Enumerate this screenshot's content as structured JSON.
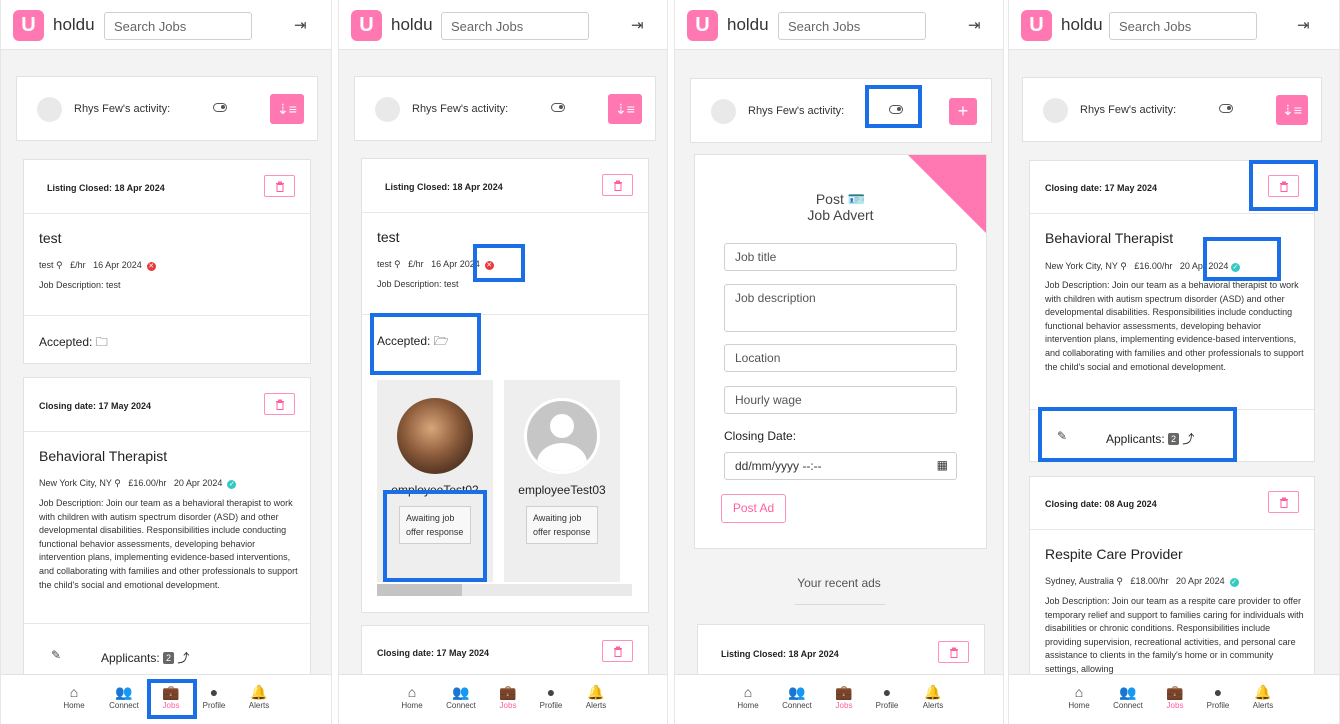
{
  "app": {
    "logo_letter": "U",
    "name": "holdu"
  },
  "search": {
    "placeholder": "Search Jobs"
  },
  "activity": {
    "label": "Rhys Few's activity:"
  },
  "nav": {
    "items": [
      "Home",
      "Connect",
      "Jobs",
      "Profile",
      "Alerts"
    ],
    "active": "Jobs"
  },
  "screen1": {
    "listing1": {
      "status": "Listing Closed: 18 Apr 2024",
      "title": "test",
      "location": "test",
      "wage": "£/hr",
      "date": "16 Apr 2024",
      "description": "Job Description: test",
      "accepted_label": "Accepted:"
    },
    "listing2": {
      "status": "Closing date: 17 May 2024",
      "title": "Behavioral Therapist",
      "location": "New York City, NY",
      "wage": "£16.00/hr",
      "date": "20 Apr 2024",
      "description": "Job Description: Join our team as a behavioral therapist to work with children with autism spectrum disorder (ASD) and other developmental disabilities. Responsibilities include conducting functional behavior assessments, developing behavior intervention plans, implementing evidence-based interventions, and collaborating with families and other professionals to support the child's social and emotional development.",
      "applicants_label": "Applicants:",
      "applicants_count": "2"
    }
  },
  "screen2": {
    "listing1": {
      "status": "Listing Closed: 18 Apr 2024",
      "title": "test",
      "location": "test",
      "wage": "£/hr",
      "date": "16 Apr 2024",
      "description": "Job Description: test",
      "accepted_label": "Accepted:"
    },
    "applicants": [
      {
        "name": "employeeTest02",
        "status": "Awaiting job offer response"
      },
      {
        "name": "employeeTest03",
        "status": "Awaiting job offer response"
      }
    ],
    "listing2": {
      "status": "Closing date: 17 May 2024"
    }
  },
  "screen3": {
    "post_title_1": "Post",
    "post_title_2": "Job Advert",
    "fields": {
      "job_title": "Job title",
      "job_description": "Job description",
      "location": "Location",
      "hourly_wage": "Hourly wage"
    },
    "closing_label": "Closing Date:",
    "date_placeholder": "dd/mm/yyyy --:--",
    "post_button": "Post Ad",
    "recent_heading": "Your recent ads",
    "recent_listing": {
      "status": "Listing Closed: 18 Apr 2024"
    }
  },
  "screen4": {
    "listing1": {
      "status": "Closing date: 17 May 2024",
      "title": "Behavioral Therapist",
      "location": "New York City, NY",
      "wage": "£16.00/hr",
      "date": "20 Apr 2024",
      "description": "Job Description: Join our team as a behavioral therapist to work with children with autism spectrum disorder (ASD) and other developmental disabilities. Responsibilities include conducting functional behavior assessments, developing behavior intervention plans, implementing evidence-based interventions, and collaborating with families and other professionals to support the child's social and emotional development.",
      "applicants_label": "Applicants:",
      "applicants_count": "2"
    },
    "listing2": {
      "status": "Closing date: 08 Aug 2024",
      "title": "Respite Care Provider",
      "location": "Sydney, Australia",
      "wage": "£18.00/hr",
      "date": "20 Apr 2024",
      "description": "Job Description: Join our team as a respite care provider to offer temporary relief and support to families caring for individuals with disabilities or chronic conditions. Responsibilities include providing supervision, recreational activities, and personal care assistance to clients in the family's home or in community settings, allowing"
    }
  },
  "colors": {
    "brand_pink": "#ff78b2",
    "highlight_blue": "#1a6fe8",
    "status_closed": "#e83a3a",
    "status_open": "#36c9c4"
  }
}
